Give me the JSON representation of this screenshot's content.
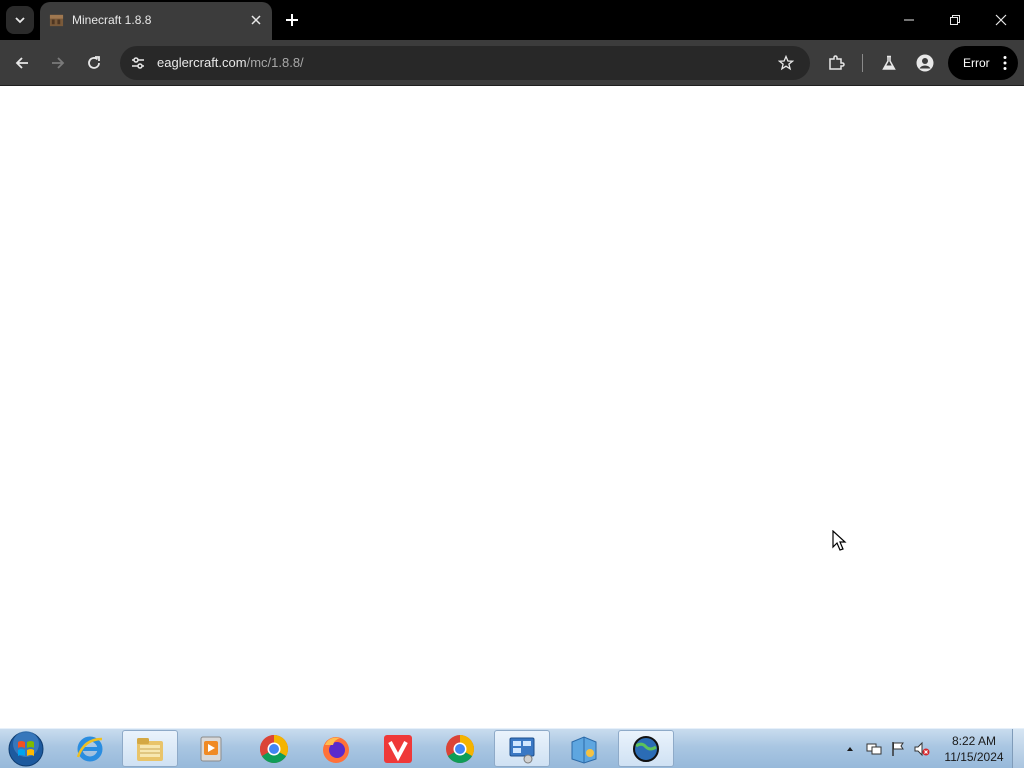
{
  "browser": {
    "tab": {
      "title": "Minecraft 1.8.8"
    },
    "omnibox": {
      "domain": "eaglercraft.com",
      "path": "/mc/1.8.8/"
    },
    "profile_status": {
      "label": "Error"
    }
  },
  "taskbar": {
    "apps": [
      {
        "name": "internet-explorer-icon"
      },
      {
        "name": "file-explorer-icon"
      },
      {
        "name": "media-player-icon"
      },
      {
        "name": "chrome-icon"
      },
      {
        "name": "firefox-icon"
      },
      {
        "name": "vivaldi-icon"
      },
      {
        "name": "chrome-alt-icon"
      },
      {
        "name": "control-panel-icon"
      },
      {
        "name": "windows-installer-icon"
      },
      {
        "name": "network-globe-icon"
      }
    ],
    "clock": {
      "time": "8:22 AM",
      "date": "11/15/2024"
    }
  },
  "colors": {
    "tabstrip": "#000000",
    "toolbar": "#3c3c3c",
    "omnibox": "#282828",
    "content": "#ffffff"
  }
}
